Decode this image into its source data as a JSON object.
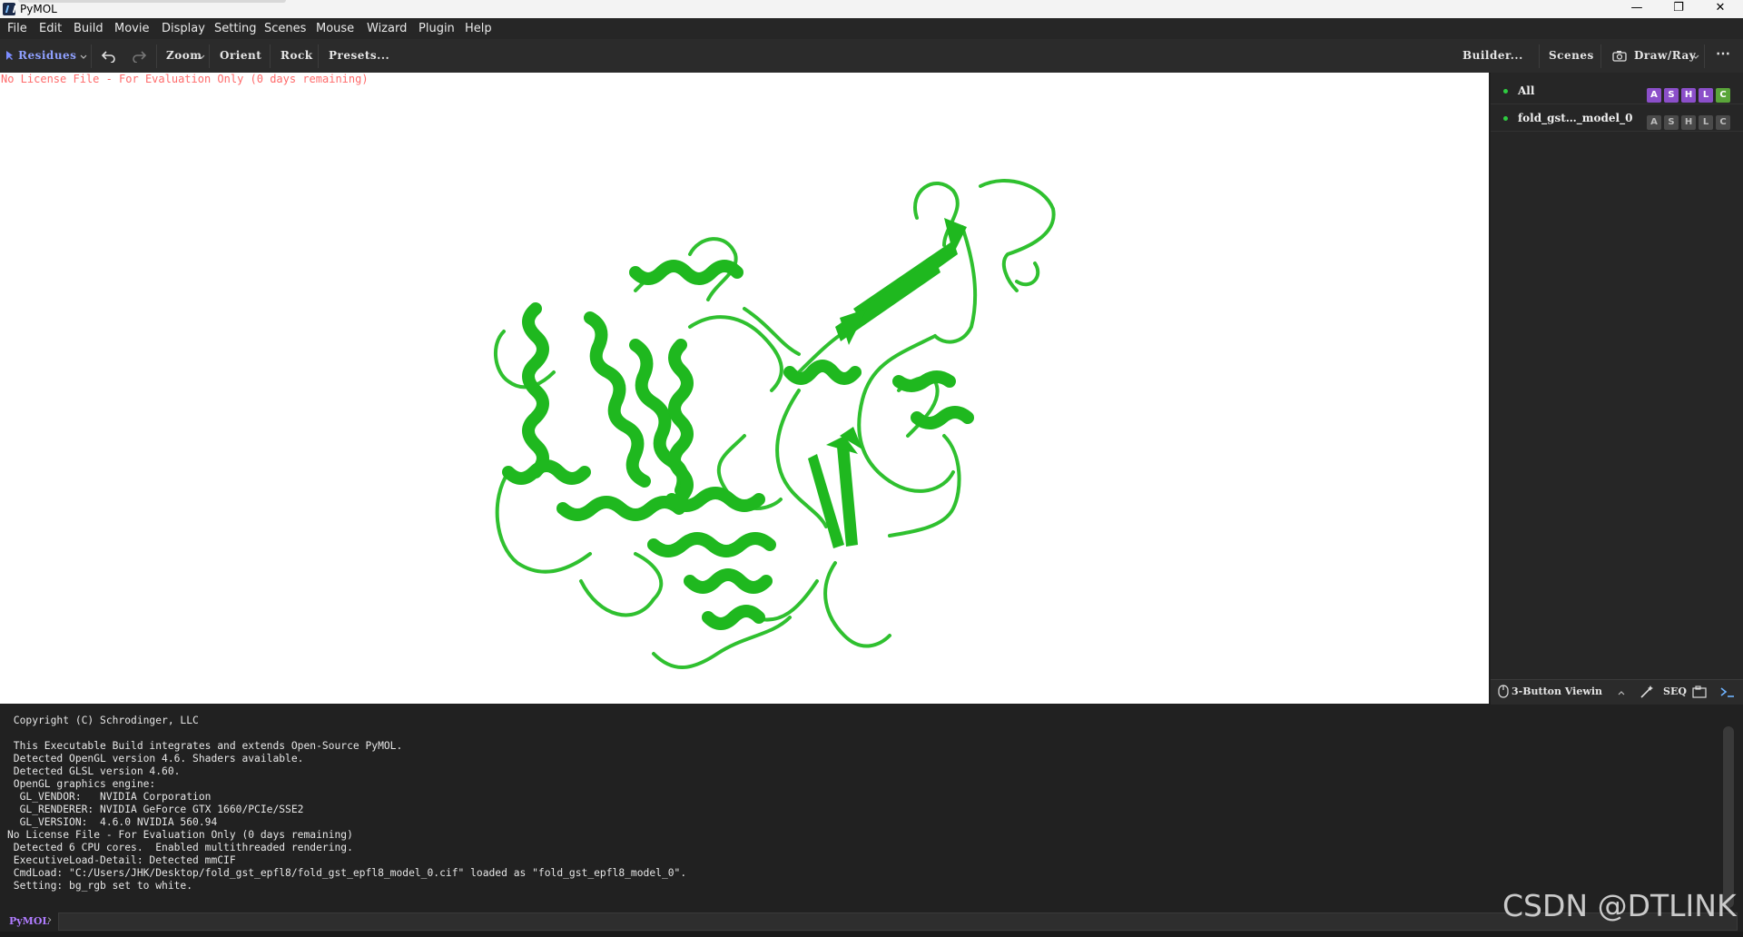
{
  "window": {
    "title": "PyMOL",
    "controls": {
      "minimize": "—",
      "maximize": "❐",
      "close": "✕"
    }
  },
  "menu": [
    "File",
    "Edit",
    "Build",
    "Movie",
    "Display",
    "Setting",
    "Scenes",
    "Mouse",
    "Wizard",
    "Plugin",
    "Help"
  ],
  "toolbar": {
    "selection_mode": "Residues",
    "zoom": "Zoom",
    "orient": "Orient",
    "rock": "Rock",
    "presets": "Presets...",
    "builder": "Builder...",
    "scenes": "Scenes",
    "draw_ray": "Draw/Ray",
    "more": "⋯"
  },
  "viewer": {
    "license_banner": "No License File - For Evaluation Only (0 days remaining)",
    "background": "#ffffff",
    "cartoon_color": "#33cc33"
  },
  "objects": [
    {
      "name": "All",
      "buttons": [
        "A",
        "S",
        "H",
        "L",
        "C"
      ],
      "colors": [
        "#8b4fc9",
        "#8b4fc9",
        "#8b4fc9",
        "#8b4fc9",
        "#5aa53a"
      ]
    },
    {
      "name": "fold_gst…_model_0",
      "buttons": [
        "A",
        "S",
        "H",
        "L",
        "C"
      ]
    }
  ],
  "toolstrip": {
    "mouse_mode": "3-Button Viewin",
    "seq": "SEQ"
  },
  "console": {
    "lines": [
      " Copyright (C) Schrodinger, LLC",
      "",
      " This Executable Build integrates and extends Open-Source PyMOL.",
      " Detected OpenGL version 4.6. Shaders available.",
      " Detected GLSL version 4.60.",
      " OpenGL graphics engine:",
      "  GL_VENDOR:   NVIDIA Corporation",
      "  GL_RENDERER: NVIDIA GeForce GTX 1660/PCIe/SSE2",
      "  GL_VERSION:  4.6.0 NVIDIA 560.94",
      "No License File - For Evaluation Only (0 days remaining)",
      " Detected 6 CPU cores.  Enabled multithreaded rendering.",
      " ExecutiveLoad-Detail: Detected mmCIF",
      " CmdLoad: \"C:/Users/JHK/Desktop/fold_gst_epfl8/fold_gst_epfl8_model_0.cif\" loaded as \"fold_gst_epfl8_model_0\".",
      " Setting: bg_rgb set to white."
    ]
  },
  "command": {
    "prompt": "PyMOL",
    "value": ""
  },
  "watermark": "CSDN @DTLINK"
}
